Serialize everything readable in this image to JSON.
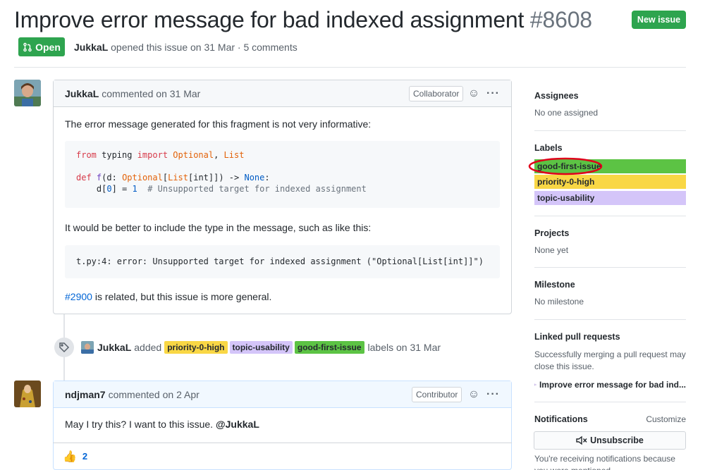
{
  "issue": {
    "title": "Improve error message for bad indexed assignment",
    "number": "#8608",
    "state": "Open",
    "author": "JukkaL",
    "meta_text": "opened this issue on 31 Mar · 5 comments",
    "new_issue_label": "New issue"
  },
  "comment1": {
    "author": "JukkaL",
    "when": "commented on 31 Mar",
    "role": "Collaborator",
    "para1": "The error message generated for this fragment is not very informative:",
    "para2": "It would be better to include the type in the message, such as like this:",
    "code2": "t.py:4: error: Unsupported target for indexed assignment (\"Optional[List[int]]\")",
    "link": "#2900",
    "para3": " is related, but this issue is more general."
  },
  "event": {
    "actor": "JukkaL",
    "verb": "added",
    "labels": [
      "priority-0-high",
      "topic-usability",
      "good-first-issue"
    ],
    "suffix": "labels on 31 Mar"
  },
  "comment2": {
    "author": "ndjman7",
    "when": "commented on 2 Apr",
    "role": "Contributor",
    "text": "May I try this? I want to this issue. ",
    "mention": "@JukkaL",
    "reaction_emoji": "👍",
    "reaction_count": "2"
  },
  "sidebar": {
    "assignees_h": "Assignees",
    "assignees_v": "No one assigned",
    "labels_h": "Labels",
    "labels": [
      {
        "name": "good-first-issue",
        "color": "#5cc344"
      },
      {
        "name": "priority-0-high",
        "color": "#f9d745"
      },
      {
        "name": "topic-usability",
        "color": "#d4c5f9"
      }
    ],
    "projects_h": "Projects",
    "projects_v": "None yet",
    "milestone_h": "Milestone",
    "milestone_v": "No milestone",
    "linked_h": "Linked pull requests",
    "linked_v": "Successfully merging a pull request may close this issue.",
    "linked_pr": "Improve error message for bad ind...",
    "notifications_h": "Notifications",
    "customize": "Customize",
    "unsubscribe": "Unsubscribe",
    "notif_reason": "You're receiving notifications because you were mentioned."
  },
  "colors": {
    "open_green": "#2ea44f",
    "link_blue": "#0366d6",
    "highlight_circle": "#e0001b"
  }
}
